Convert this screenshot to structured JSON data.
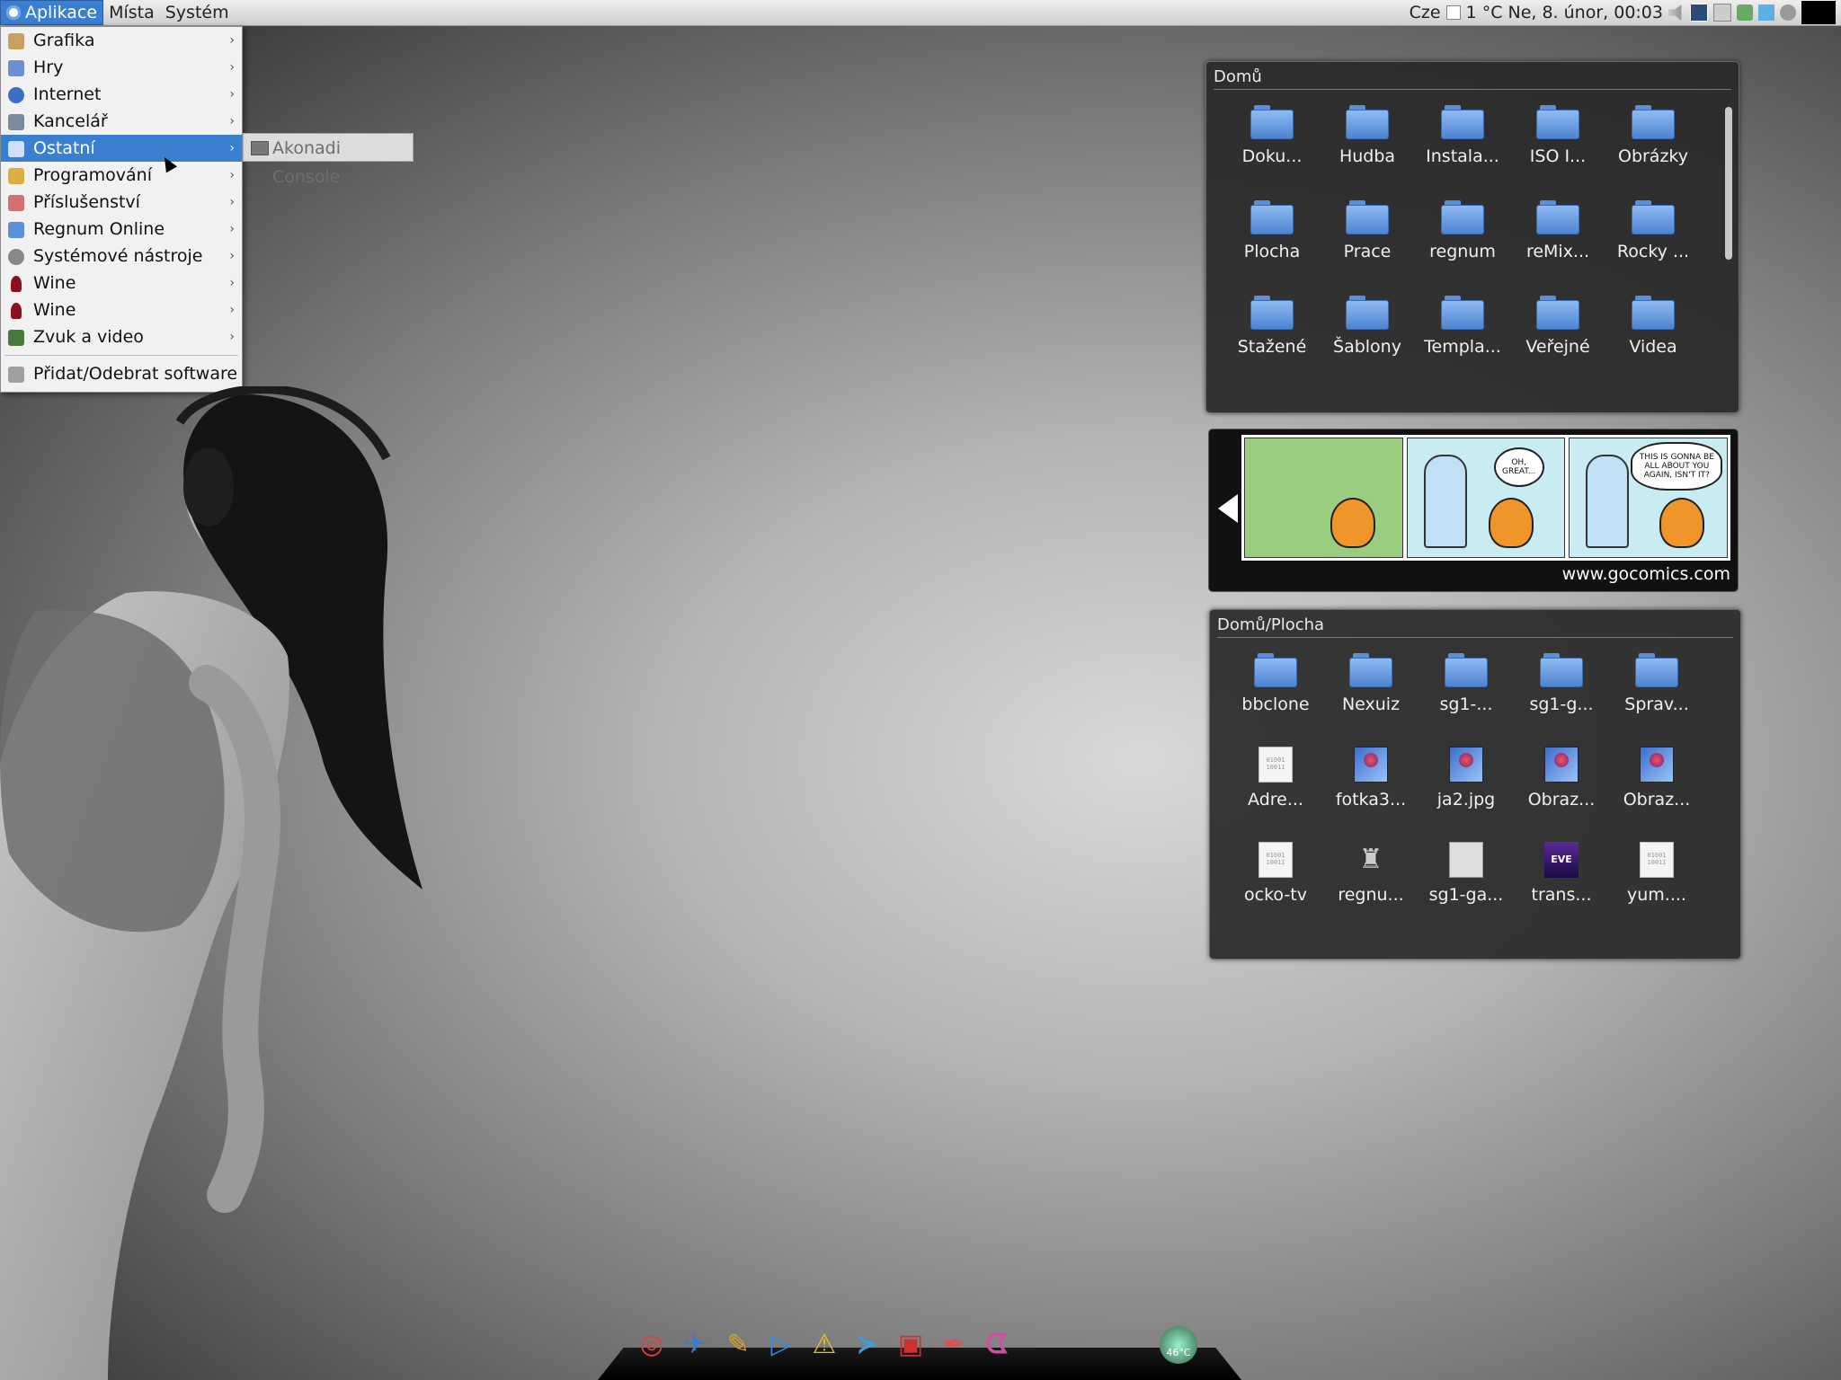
{
  "top_panel": {
    "menus": [
      "Aplikace",
      "Místa",
      "Systém"
    ],
    "locale": "Cze",
    "weather": "1 °C",
    "clock": "Ne,  8. únor, 00:03"
  },
  "app_menu": {
    "items": [
      {
        "label": "Grafika",
        "icon": "graphics-icon",
        "color": "#c8a060"
      },
      {
        "label": "Hry",
        "icon": "games-icon",
        "color": "#6b8fd0"
      },
      {
        "label": "Internet",
        "icon": "globe-icon",
        "color": "#3a6fc4"
      },
      {
        "label": "Kancelář",
        "icon": "office-icon",
        "color": "#7a8a9a"
      },
      {
        "label": "Ostatní",
        "icon": "other-icon",
        "color": "#cfdff5"
      },
      {
        "label": "Programování",
        "icon": "programming-icon",
        "color": "#d8b040"
      },
      {
        "label": "Příslušenství",
        "icon": "accessories-icon",
        "color": "#d07070"
      },
      {
        "label": "Regnum Online",
        "icon": "folder-icon",
        "color": "#5b8fd8"
      },
      {
        "label": "Systémové nástroje",
        "icon": "system-tools-icon",
        "color": "#888888"
      },
      {
        "label": "Wine",
        "icon": "wine-icon",
        "color": "#8a1020"
      },
      {
        "label": "Wine",
        "icon": "wine-icon",
        "color": "#8a1020"
      },
      {
        "label": "Zvuk a video",
        "icon": "sound-video-icon",
        "color": "#4a7a3a"
      }
    ],
    "footer": "Přidat/Odebrat software",
    "submenu_item": "Akonadi Console"
  },
  "home_widget": {
    "title": "Domů",
    "items": [
      {
        "label": "Doku...",
        "type": "folder"
      },
      {
        "label": "Hudba",
        "type": "folder"
      },
      {
        "label": "Instala...",
        "type": "folder"
      },
      {
        "label": "ISO I...",
        "type": "folder"
      },
      {
        "label": "Obrázky",
        "type": "folder"
      },
      {
        "label": "Plocha",
        "type": "folder"
      },
      {
        "label": "Prace",
        "type": "folder"
      },
      {
        "label": "regnum",
        "type": "folder"
      },
      {
        "label": "reMix...",
        "type": "folder"
      },
      {
        "label": "Rocky ...",
        "type": "folder"
      },
      {
        "label": "Stažené",
        "type": "folder"
      },
      {
        "label": "Šablony",
        "type": "folder"
      },
      {
        "label": "Templa...",
        "type": "folder"
      },
      {
        "label": "Veřejné",
        "type": "folder"
      },
      {
        "label": "Videa",
        "type": "folder"
      }
    ]
  },
  "comic_widget": {
    "source": "www.gocomics.com",
    "bubble_1": "OH, GREAT...",
    "bubble_2": "THIS IS GONNA BE ALL ABOUT YOU AGAIN, ISN'T IT?"
  },
  "desktop_widget": {
    "title": "Domů/Plocha",
    "items": [
      {
        "label": "bbclone",
        "type": "folder"
      },
      {
        "label": "Nexuiz",
        "type": "folder"
      },
      {
        "label": "sg1-...",
        "type": "folder"
      },
      {
        "label": "sg1-g...",
        "type": "folder"
      },
      {
        "label": "Sprav...",
        "type": "folder"
      },
      {
        "label": "Adre...",
        "type": "bin"
      },
      {
        "label": "fotka3...",
        "type": "img"
      },
      {
        "label": "ja2.jpg",
        "type": "img"
      },
      {
        "label": "Obraz...",
        "type": "img"
      },
      {
        "label": "Obraz...",
        "type": "img"
      },
      {
        "label": "ocko-tv",
        "type": "bin"
      },
      {
        "label": "regnu...",
        "type": "glyph"
      },
      {
        "label": "sg1-ga...",
        "type": "exe"
      },
      {
        "label": "trans...",
        "type": "eve"
      },
      {
        "label": "yum....",
        "type": "bin"
      }
    ],
    "eve_logo": "EVE"
  },
  "dock": {
    "icons": [
      {
        "name": "firefox-icon",
        "glyph": "◎",
        "color": "#e04040"
      },
      {
        "name": "mail-icon",
        "glyph": "✈",
        "color": "#3a7ad0"
      },
      {
        "name": "pidgin-icon",
        "glyph": "✎",
        "color": "#d8a020"
      },
      {
        "name": "media-player-icon",
        "glyph": "▷",
        "color": "#3a8ae0"
      },
      {
        "name": "warning-icon",
        "glyph": "⚠",
        "color": "#e0c020"
      },
      {
        "name": "terminal-icon",
        "glyph": "≻",
        "color": "#3aa0e0"
      },
      {
        "name": "toolbox-icon",
        "glyph": "▣",
        "color": "#d03030"
      },
      {
        "name": "pen-icon",
        "glyph": "✒",
        "color": "#e05050"
      },
      {
        "name": "pacman-icon",
        "glyph": "ᗧ",
        "color": "#d050a0"
      }
    ],
    "temperature": "46°C"
  }
}
